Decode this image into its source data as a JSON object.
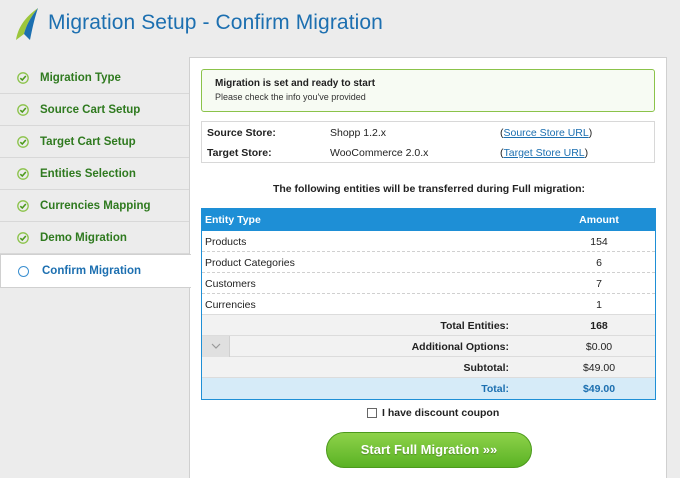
{
  "header": {
    "title": "Migration Setup - Confirm Migration"
  },
  "sidebar": {
    "steps": [
      {
        "label": "Migration Type",
        "state": "done"
      },
      {
        "label": "Source Cart Setup",
        "state": "done"
      },
      {
        "label": "Target Cart Setup",
        "state": "done"
      },
      {
        "label": "Entities Selection",
        "state": "done"
      },
      {
        "label": "Currencies Mapping",
        "state": "done"
      },
      {
        "label": "Demo Migration",
        "state": "done"
      },
      {
        "label": "Confirm Migration",
        "state": "active"
      }
    ]
  },
  "notice": {
    "title": "Migration is set and ready to start",
    "subtitle": "Please check the info you've provided"
  },
  "stores": {
    "source": {
      "label": "Source Store:",
      "value": "Shopp 1.2.x",
      "link": "Source Store URL"
    },
    "target": {
      "label": "Target Store:",
      "value": "WooCommerce 2.0.x",
      "link": "Target Store URL"
    }
  },
  "entities": {
    "caption": "The following entities will be transferred during Full migration:",
    "columns": [
      "Entity Type",
      "Amount"
    ],
    "rows": [
      {
        "name": "Products",
        "amount": "154"
      },
      {
        "name": "Product Categories",
        "amount": "6"
      },
      {
        "name": "Customers",
        "amount": "7"
      },
      {
        "name": "Currencies",
        "amount": "1"
      }
    ],
    "summary": {
      "total_entities_label": "Total Entities:",
      "total_entities": "168",
      "additional_label": "Additional Options:",
      "additional": "$0.00",
      "subtotal_label": "Subtotal:",
      "subtotal": "$49.00",
      "total_label": "Total:",
      "total": "$49.00"
    }
  },
  "coupon": {
    "label": "I have discount coupon",
    "checked": false
  },
  "actions": {
    "start_label": "Start Full Migration »»"
  },
  "colors": {
    "accent": "#1c6fb0",
    "table_header": "#1e8fd6",
    "success": "#5ab224"
  }
}
